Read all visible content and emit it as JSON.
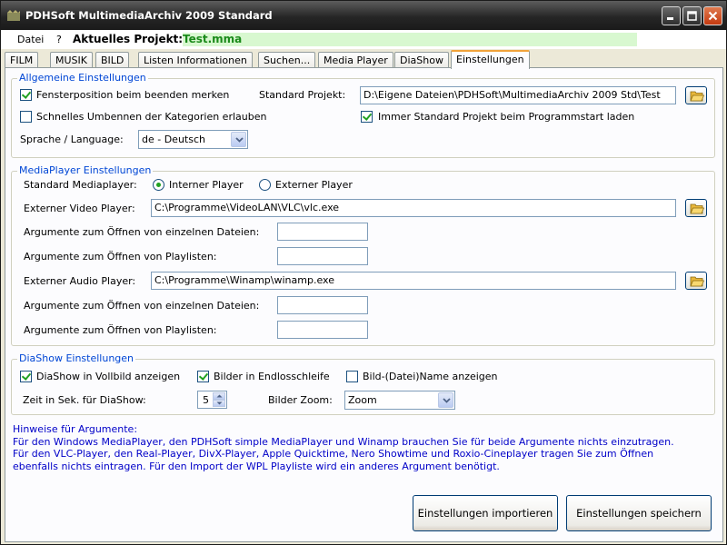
{
  "window": {
    "title": "PDHSoft MultimediaArchiv 2009 Standard"
  },
  "menu": {
    "datei": "Datei",
    "help": "?",
    "project_label": "Aktuelles Projekt:",
    "project_name": "Test.mma"
  },
  "tabs": [
    "FILM",
    "MUSIK",
    "BILD",
    "Listen Informationen",
    "Suchen...",
    "Media Player",
    "DiaShow",
    "Einstellungen"
  ],
  "active_tab": "Einstellungen",
  "general": {
    "title": "Allgemeine Einstellungen",
    "window_pos_label": "Fensterposition beim beenden merken",
    "window_pos_checked": true,
    "std_project_label": "Standard Projekt:",
    "std_project_path": "D:\\Eigene Dateien\\PDHSoft\\MultimediaArchiv 2009 Std\\Test",
    "quick_rename_label": "Schnelles Umbennen der Kategorien erlauben",
    "quick_rename_checked": false,
    "always_std_label": "Immer Standard Projekt beim Programmstart laden",
    "always_std_checked": true,
    "language_label": "Sprache / Language:",
    "language_value": "de - Deutsch"
  },
  "mediaplayer": {
    "title": "MediaPlayer Einstellungen",
    "std_label": "Standard Mediaplayer:",
    "internal_label": "Interner Player",
    "external_label": "Externer Player",
    "selected": "internal",
    "video_label": "Externer Video Player:",
    "video_path": "C:\\Programme\\VideoLAN\\VLC\\vlc.exe",
    "video_args_files_label": "Argumente zum Öffnen von einzelnen Dateien:",
    "video_args_files_value": "",
    "video_args_playlist_label": "Argumente zum Öffnen von Playlisten:",
    "video_args_playlist_value": "",
    "audio_label": "Externer Audio Player:",
    "audio_path": "C:\\Programme\\Winamp\\winamp.exe",
    "audio_args_files_label": "Argumente zum Öffnen von einzelnen Dateien:",
    "audio_args_files_value": "",
    "audio_args_playlist_label": "Argumente zum Öffnen von Playlisten:",
    "audio_args_playlist_value": ""
  },
  "diashow": {
    "title": "DiaShow Einstellungen",
    "fullscreen_label": "DiaShow in Vollbild anzeigen",
    "fullscreen_checked": true,
    "loop_label": "Bilder in Endlosschleife",
    "loop_checked": true,
    "showname_label": "Bild-(Datei)Name anzeigen",
    "showname_checked": false,
    "time_label": "Zeit in Sek. für DiaShow:",
    "time_value": "5",
    "zoom_label": "Bilder Zoom:",
    "zoom_value": "Zoom"
  },
  "hints": {
    "heading": "Hinweise für Argumente:",
    "lines": [
      "Für den Windows MediaPlayer, den PDHSoft simple MediaPlayer und Winamp brauchen Sie für beide Argumente nichts einzutragen.",
      "Für den VLC-Player, den Real-Player, DivX-Player, Apple Quicktime, Nero Showtime und Roxio-Cineplayer tragen Sie zum Öffnen",
      "ebenfalls nichts eintragen. Für den Import der WPL Playliste wird ein anderes Argument benötigt."
    ]
  },
  "buttons": {
    "import": "Einstellungen importieren",
    "save": "Einstellungen speichern"
  },
  "colors": {
    "project_name": "#1a8a1a",
    "group_title": "#0046d5",
    "hints_text": "#0000c8",
    "check_mark": "#21a121"
  },
  "icons": {
    "folder": "folder-open-icon",
    "minimize": "minimize-icon",
    "maximize": "maximize-icon",
    "close": "close-icon",
    "dropdown": "chevron-down-icon"
  }
}
